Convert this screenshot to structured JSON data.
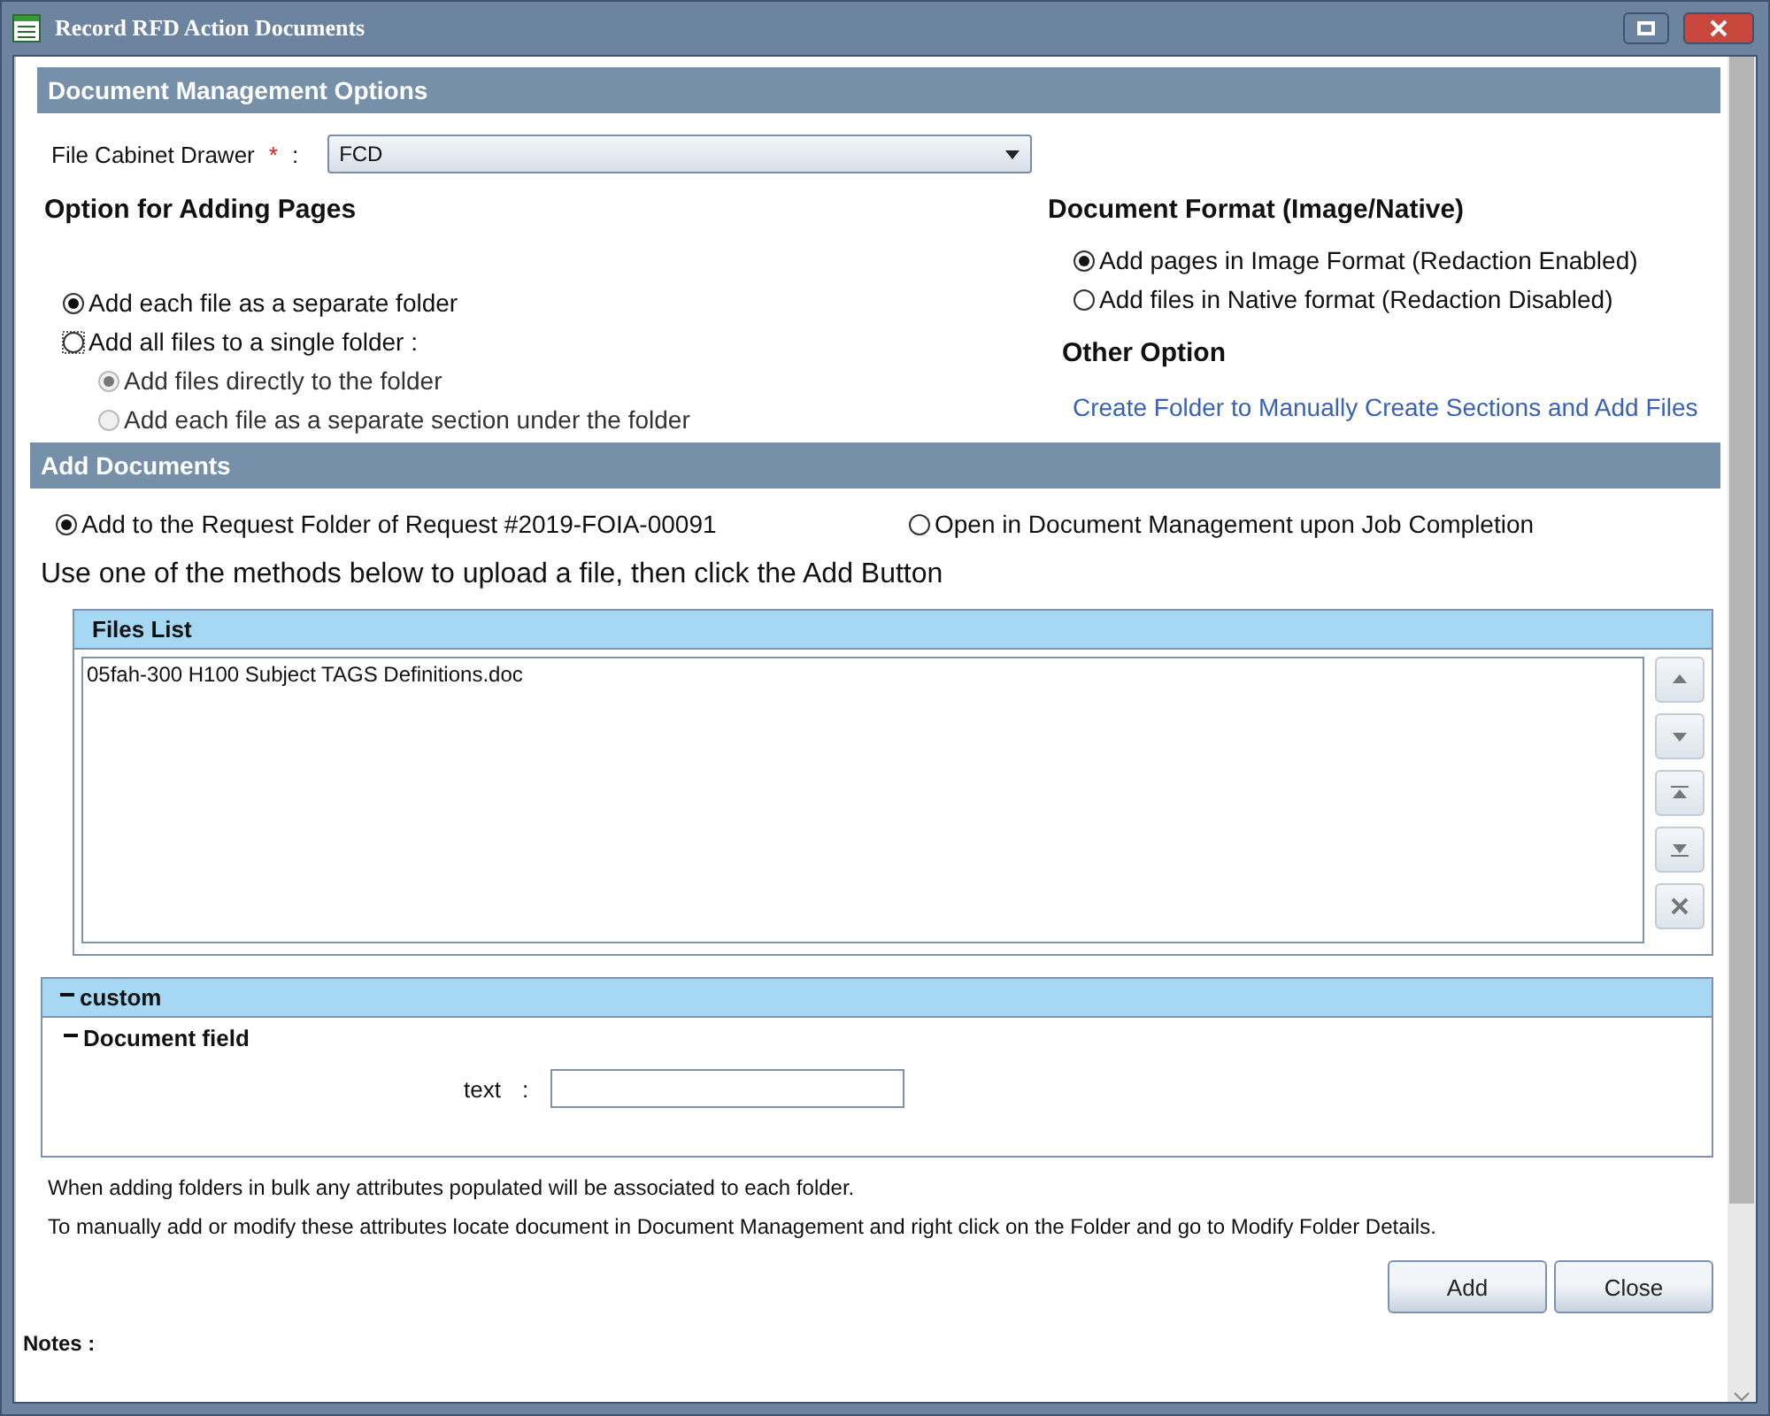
{
  "window": {
    "title": "Record RFD Action Documents"
  },
  "management": {
    "header": "Document Management Options",
    "drawer_label": "File Cabinet Drawer",
    "required_mark": "*",
    "drawer_colon": ":",
    "drawer_value": "FCD",
    "pages_heading": "Option for Adding Pages",
    "page_options": [
      {
        "label": "Add each file as a separate folder",
        "selected": true,
        "focused": false
      },
      {
        "label": "Add all files to a single folder :",
        "selected": false,
        "focused": true,
        "children": [
          {
            "label": "Add files directly to the folder",
            "selected": true,
            "disabled": true
          },
          {
            "label": "Add each file as a separate section under the folder",
            "selected": false,
            "disabled": true
          }
        ]
      }
    ],
    "format_heading": "Document Format (Image/Native)",
    "format_options": [
      {
        "label": "Add pages in Image Format (Redaction Enabled)",
        "selected": true
      },
      {
        "label": "Add files in Native format (Redaction Disabled)",
        "selected": false
      }
    ],
    "other_heading": "Other Option",
    "other_link": "Create Folder to Manually Create Sections and Add Files"
  },
  "add_documents": {
    "header": "Add Documents",
    "destination_options": [
      {
        "label": "Add to the Request Folder of Request #2019-FOIA-00091",
        "selected": true
      },
      {
        "label": "Open in Document Management upon Job Completion",
        "selected": false
      }
    ],
    "instruction": "Use one of the methods below to upload a file, then click the Add Button",
    "files_list": {
      "header": "Files List",
      "files": [
        "05fah-300 H100 Subject TAGS Definitions.doc"
      ]
    }
  },
  "custom": {
    "header": "custom",
    "expanded": true,
    "group": {
      "title": "Document field",
      "expanded": true,
      "field_label": "text",
      "colon": ":"
    }
  },
  "notes_text": [
    "When adding folders in bulk any attributes populated will be associated to each folder.",
    "To manually add or modify these attributes locate document in Document Management and right click on the Folder and go to Modify Folder Details."
  ],
  "buttons": [
    "Add",
    "Close"
  ],
  "notes_label": "Notes :"
}
